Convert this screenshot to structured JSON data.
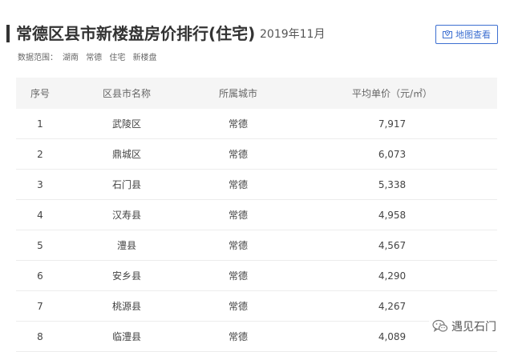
{
  "page": {
    "title": "常德区县市新楼盘房价排行(住宅)",
    "date": "2019年11月",
    "map_button": {
      "icon": "map-pin-icon",
      "label": "地图查看"
    },
    "scope": {
      "label": "数据范围：",
      "items": [
        "湖南",
        "常德",
        "住宅",
        "新楼盘"
      ]
    }
  },
  "table": {
    "headers": {
      "rank": "序号",
      "name": "区县市名称",
      "city": "所属城市",
      "price": "平均单价（元/㎡）"
    },
    "rows": [
      {
        "rank": "1",
        "name": "武陵区",
        "city": "常德",
        "price": "7,917"
      },
      {
        "rank": "2",
        "name": "鼎城区",
        "city": "常德",
        "price": "6,073"
      },
      {
        "rank": "3",
        "name": "石门县",
        "city": "常德",
        "price": "5,338"
      },
      {
        "rank": "4",
        "name": "汉寿县",
        "city": "常德",
        "price": "4,958"
      },
      {
        "rank": "5",
        "name": "澧县",
        "city": "常德",
        "price": "4,567"
      },
      {
        "rank": "6",
        "name": "安乡县",
        "city": "常德",
        "price": "4,290"
      },
      {
        "rank": "7",
        "name": "桃源县",
        "city": "常德",
        "price": "4,267"
      },
      {
        "rank": "8",
        "name": "临澧县",
        "city": "常德",
        "price": "4,089"
      }
    ]
  },
  "watermark": {
    "icon": "wechat-icon",
    "text": "遇见石门"
  },
  "colors": {
    "accent": "#3d6fd1",
    "header_bg": "#f5f5f5"
  }
}
